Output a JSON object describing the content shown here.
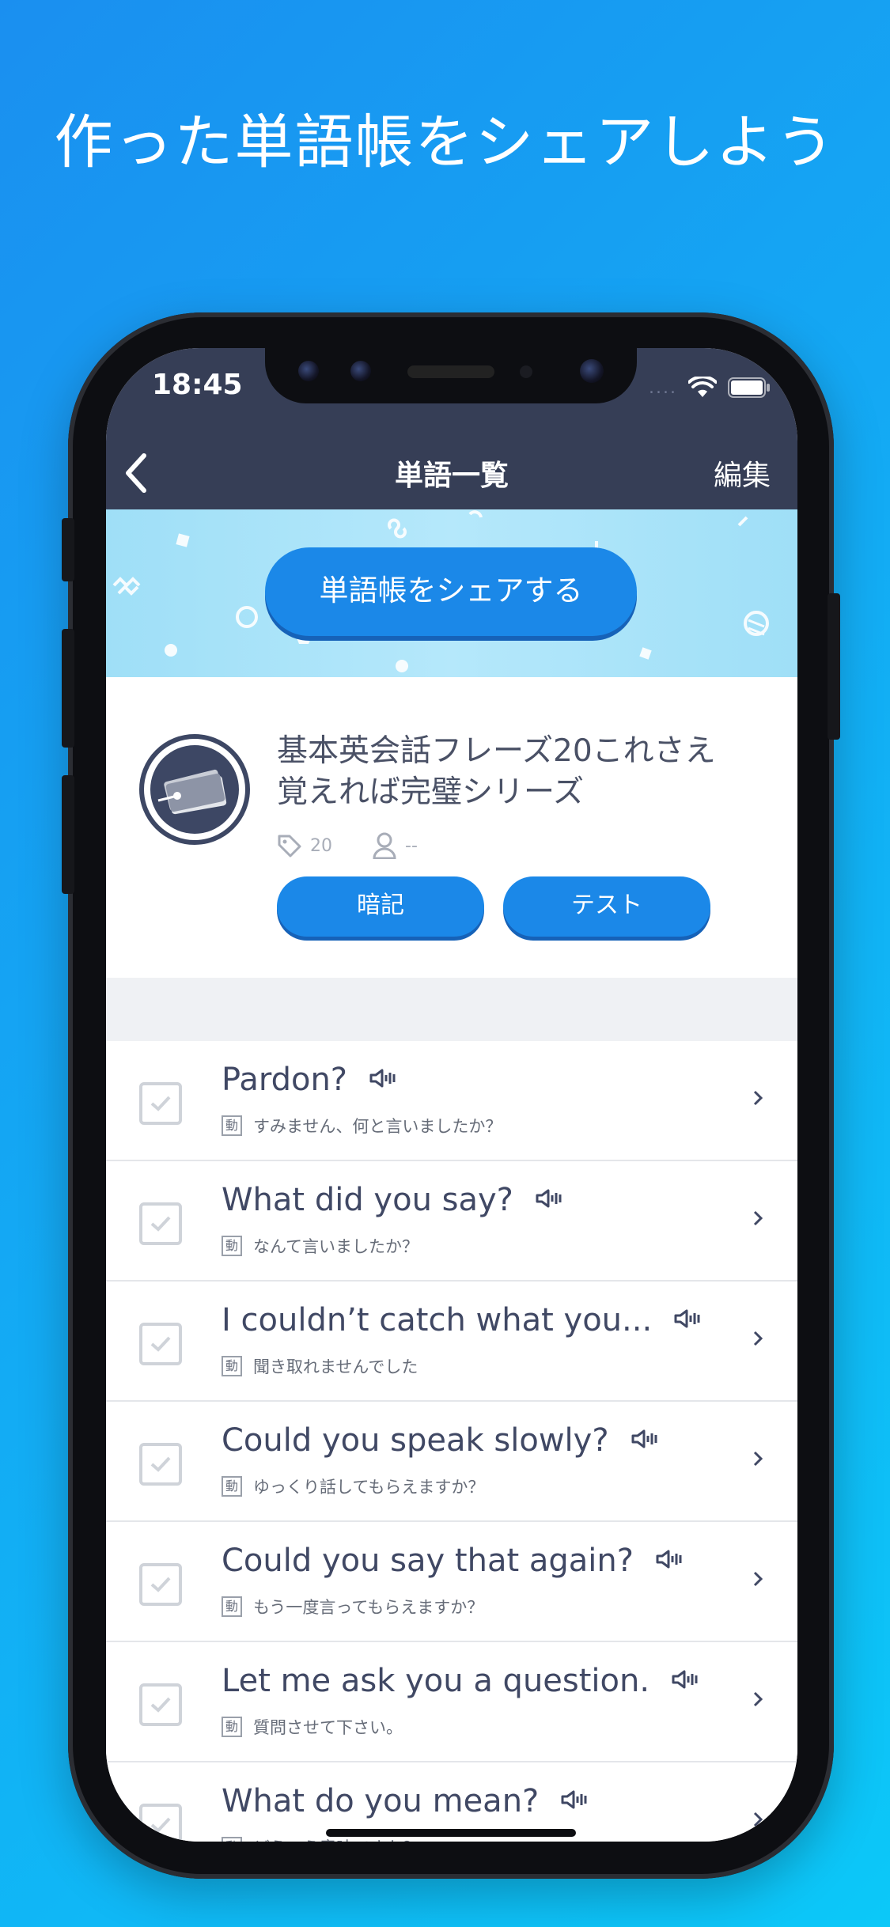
{
  "promo": {
    "title": "作った単語帳をシェアしよう"
  },
  "status_bar": {
    "time": "18:45",
    "signal": "....",
    "icons": [
      "wifi-icon",
      "battery-icon"
    ]
  },
  "nav": {
    "back_icon": "chevron-left-icon",
    "title": "単語一覧",
    "edit_label": "編集"
  },
  "banner": {
    "share_label": "単語帳をシェアする"
  },
  "deck": {
    "title": "基本英会話フレーズ20これさえ覚えれば完璧シリーズ",
    "tag_count": "20",
    "author": "--",
    "memorize_label": "暗記",
    "test_label": "テスト"
  },
  "words": [
    {
      "word": "Pardon?",
      "pos": "動",
      "meaning": "すみません、何と言いましたか？"
    },
    {
      "word": "What did you say?",
      "pos": "動",
      "meaning": "なんて言いましたか？"
    },
    {
      "word": "I couldn’t catch what you...",
      "pos": "動",
      "meaning": "聞き取れませんでした"
    },
    {
      "word": "Could you speak slowly?",
      "pos": "動",
      "meaning": "ゆっくり話してもらえますか？"
    },
    {
      "word": "Could you say that again?",
      "pos": "動",
      "meaning": "もう一度言ってもらえますか？"
    },
    {
      "word": "Let me ask you a question.",
      "pos": "動",
      "meaning": "質問させて下さい。"
    },
    {
      "word": "What do you mean?",
      "pos": "動",
      "meaning": "どういう意味ですか？"
    }
  ],
  "colors": {
    "nav": "#363e56",
    "accent": "#1b88e8",
    "background_start": "#1a8ff0",
    "background_end": "#0cc8f8"
  }
}
